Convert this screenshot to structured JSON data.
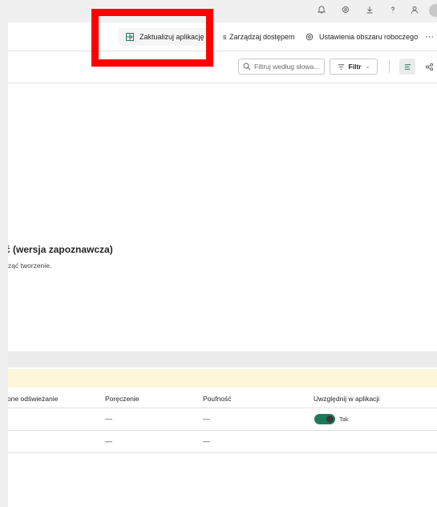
{
  "topbar": {
    "icons": [
      "bell-icon",
      "gear-icon",
      "download-icon",
      "help-icon",
      "person-icon",
      "avatar"
    ]
  },
  "commands": {
    "update_app": "Zaktualizuj aplikację",
    "hidden_fragment": "s",
    "manage_access": "Zarządzaj dostępem",
    "workspace_settings": "Ustawienia obszaru roboczego",
    "more": "···"
  },
  "filterbar": {
    "search_placeholder": "Filtruj według słowa...",
    "filter_label": "Filtr",
    "filter_chevron": "⌄"
  },
  "empty_state": {
    "title": "ć (wersja zapoznawcza)",
    "subtitle": "ząć tworzenie."
  },
  "table": {
    "columns": [
      "one odświeżanie",
      "Poręczenie",
      "Poufność",
      "Uwzględnij w aplikacji"
    ],
    "rows": [
      {
        "endorsement": "—",
        "sensitivity": "—",
        "include_label": "Tak",
        "include": true
      },
      {
        "endorsement": "—",
        "sensitivity": "—"
      }
    ]
  },
  "colors": {
    "accent": "#1f7a5c",
    "highlight_box": "#ff0000",
    "warning_band": "#fdf6d8"
  }
}
